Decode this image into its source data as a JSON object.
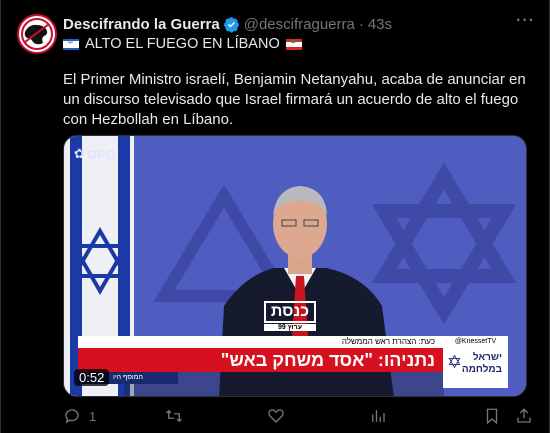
{
  "author": {
    "display_name": "Descifrando la Guerra",
    "handle": "@descifraguerra",
    "separator": "·",
    "time": "43s"
  },
  "tweet": {
    "headline": "ALTO EL FUEGO EN LÍBANO",
    "body": "El Primer Ministro israelí, Benjamin Netanyahu, acaba de anunciar en un discurso televisado que Israel firmará un acuerdo de alto el fuego con Hezbollah en Líbano."
  },
  "media": {
    "gpo_label": "GPO",
    "knesset_logo": "כנסת",
    "knesset_logo_sub": "ערוץ 99",
    "lower_top": "כעת: הצהרת ראש הממשלה",
    "knesset_tv": "@KnessetTV",
    "headline": "נתניהו: \"אסד משחק באש\"",
    "war_label_line1": "ישראל",
    "war_label_line2": "במלחמה",
    "lower_sub": "המוסף היו",
    "duration": "0:52"
  },
  "actions": {
    "reply_count": "1"
  },
  "colors": {
    "verified": "#1d9bf0",
    "muted": "#71767b",
    "ticker_red": "#d6101f"
  }
}
